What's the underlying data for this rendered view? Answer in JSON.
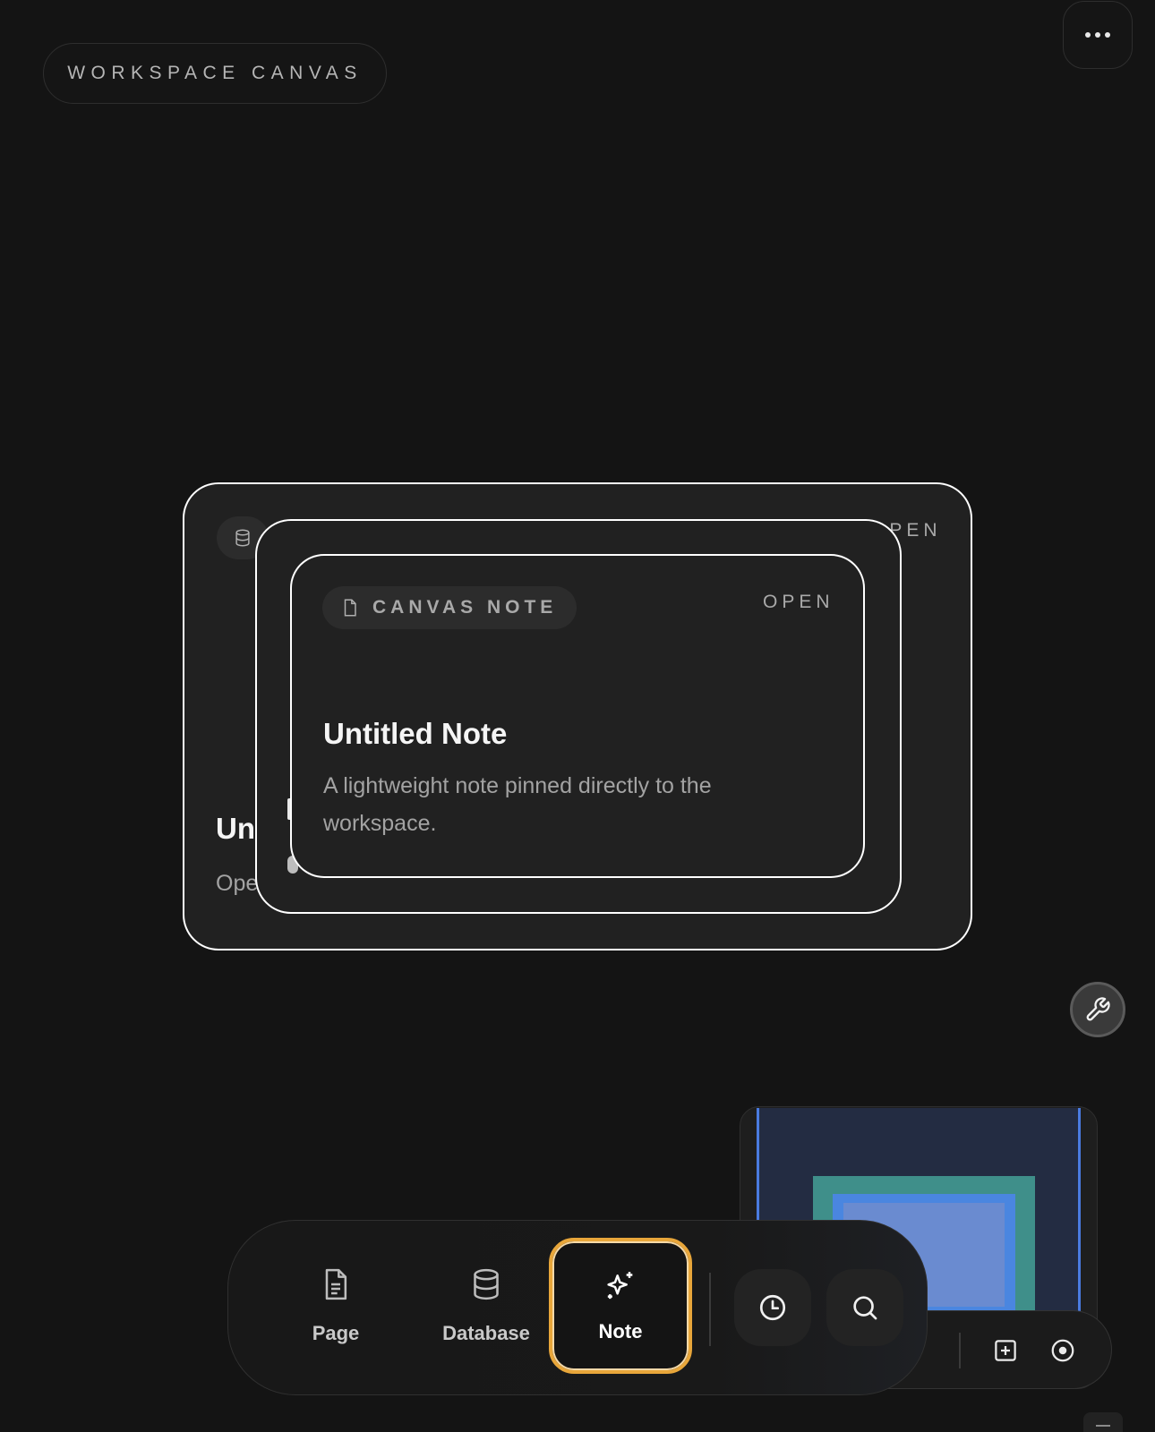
{
  "header": {
    "workspace_label": "WORKSPACE CANVAS",
    "more_icon": "more-horizontal-icon"
  },
  "cards": [
    {
      "chip_icon": "database-icon",
      "open_label": "OPEN",
      "title": "Un",
      "subtitle": "Ope"
    },
    {
      "chip_icon": "file-icon"
    },
    {
      "chip_icon": "file-icon",
      "chip_label": "CANVAS NOTE",
      "open_label": "OPEN",
      "title": "Untitled Note",
      "description": "A lightweight note pinned directly to the workspace."
    }
  ],
  "dock": {
    "items": [
      {
        "label": "Page",
        "icon": "page-icon"
      },
      {
        "label": "Database",
        "icon": "database-icon"
      },
      {
        "label": "Note",
        "icon": "sparkles-icon",
        "active": true
      }
    ],
    "history_icon": "clock-icon",
    "search_icon": "search-icon",
    "accent": "#e8a63a"
  },
  "tools": {
    "wrench_icon": "wrench-icon",
    "minimap": {
      "add_icon": "add-square-icon",
      "recenter_icon": "target-icon"
    }
  }
}
